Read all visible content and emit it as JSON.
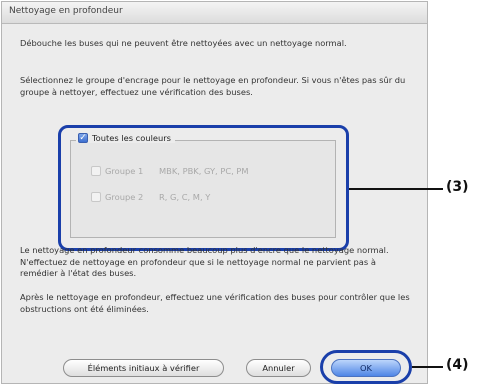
{
  "dialog": {
    "title": "Nettoyage en profondeur",
    "intro": "Débouche les buses qui ne peuvent être nettoyées avec un nettoyage normal.",
    "instruction": "Sélectionnez le groupe d'encrage pour le nettoyage en profondeur. Si vous n'êtes pas sûr du groupe à nettoyer, effectuez une vérification des buses.",
    "all_colors": {
      "label": "Toutes les couleurs",
      "checked": true
    },
    "groups": [
      {
        "name": "Groupe 1",
        "colors": "MBK, PBK, GY, PC, PM",
        "checked": false,
        "enabled": false
      },
      {
        "name": "Groupe 2",
        "colors": "R, G, C, M, Y",
        "checked": false,
        "enabled": false
      }
    ],
    "warning": "Le nettoyage en profondeur consomme beaucoup plus d'encre que le nettoyage normal. N'effectuez de nettoyage en profondeur que si le nettoyage normal ne parvient pas à remédier à l'état des buses.",
    "after_note": "Après le nettoyage en profondeur, effectuez une vérification des buses pour contrôler que les obstructions ont été éliminées.",
    "buttons": {
      "elements": "Éléments initiaux à vérifier",
      "cancel": "Annuler",
      "ok": "OK"
    }
  },
  "callouts": {
    "c3": "(3)",
    "c4": "(4)"
  },
  "colors": {
    "highlight": "#1a3faa",
    "default_button": "#4f86e6"
  }
}
